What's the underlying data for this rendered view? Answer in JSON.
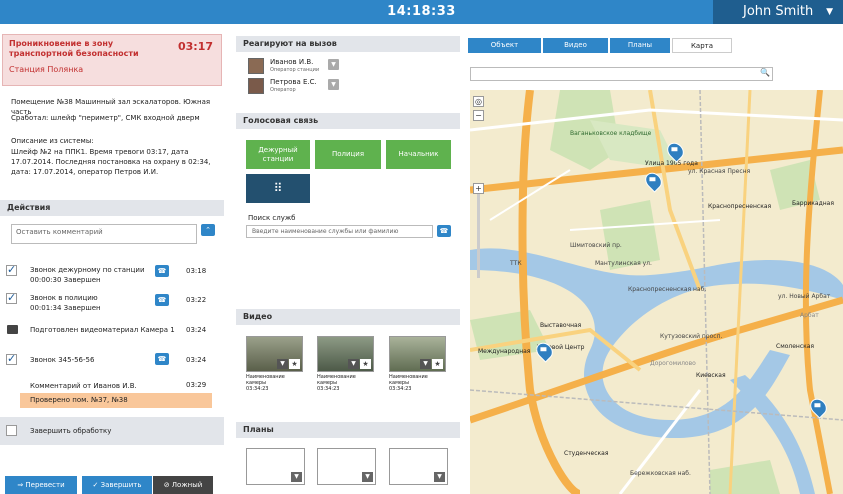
{
  "header": {
    "clock": "14:18:33",
    "user": "John Smith"
  },
  "alert": {
    "title": "Проникновение в зону транспортной безопасности",
    "time": "03:17",
    "station": "Станция Полянка"
  },
  "incident": {
    "room": "Помещение №38 Машинный зал эскалаторов. Южная часть",
    "triggered": "Сработал: шлейф \"периметр\", СМК входной дверм",
    "desc_label": "Описание из системы:",
    "desc": "Шлейф №2 на ППК1. Время тревоги 03:17, дата 17.07.2014. Последняя постановка на охрану в 02:34, дата: 17.07.2014, оператор Петров И.И."
  },
  "actions": {
    "title": "Действия",
    "comment_placeholder": "Оставить комментарий",
    "items": [
      {
        "label": "Звонок дежурному по станции",
        "sub": "00:00:30 Завершен",
        "time": "03:18"
      },
      {
        "label": "Звонок в полицию",
        "sub": "00:01:34 Завершен",
        "time": "03:22"
      },
      {
        "label": "Подготовлен видеоматериал Камера 1",
        "sub": "",
        "time": "03:24"
      },
      {
        "label": "Звонок 345-56-56",
        "sub": "",
        "time": "03:24"
      }
    ],
    "comment_by": "Комментарий от Иванов И.В.",
    "comment_time": "03:29",
    "comment_text": "Проверено пом. №37, №38",
    "finish_label": "Завершить обработку",
    "btn_transfer": "Перевести",
    "btn_finish": "Завершить",
    "btn_false": "Ложный"
  },
  "respond": {
    "title": "Реагируют на вызов",
    "people": [
      {
        "name": "Иванов И.В.",
        "role": "Оператор станции"
      },
      {
        "name": "Петрова Е.С.",
        "role": "Оператор"
      }
    ]
  },
  "voice": {
    "title": "Голосовая связь",
    "buttons": [
      "Дежурный станции",
      "Полиция",
      "Начальник"
    ],
    "search_label": "Поиск служб",
    "search_placeholder": "Введите наименование службы или фамилию"
  },
  "video": {
    "title": "Видео",
    "items": [
      {
        "name": "Наименование камеры",
        "time": "03:34:23"
      },
      {
        "name": "Наименование камеры",
        "time": "03:34:23"
      },
      {
        "name": "Наименование камеры",
        "time": "03:34:23"
      }
    ]
  },
  "plans": {
    "title": "Планы"
  },
  "tabs": [
    "Объект",
    "Видео",
    "Планы",
    "Карта"
  ],
  "map": {
    "labels": [
      "Улица 1905 года",
      "ул. Красная Пресня",
      "Баррикадная",
      "Краснопресненская",
      "Шмитовский пр.",
      "Мантулинская ул.",
      "Краснопресненская наб.",
      "ул. Новый Арбат",
      "Арбат",
      "Выставочная",
      "Деловой Центр",
      "Международная",
      "Кутузовский просп.",
      "Дорогомилово",
      "Киевская",
      "Смоленская",
      "Студенческая",
      "Бережковская наб.",
      "ТТК",
      "Ваганьковское кладбище"
    ]
  }
}
